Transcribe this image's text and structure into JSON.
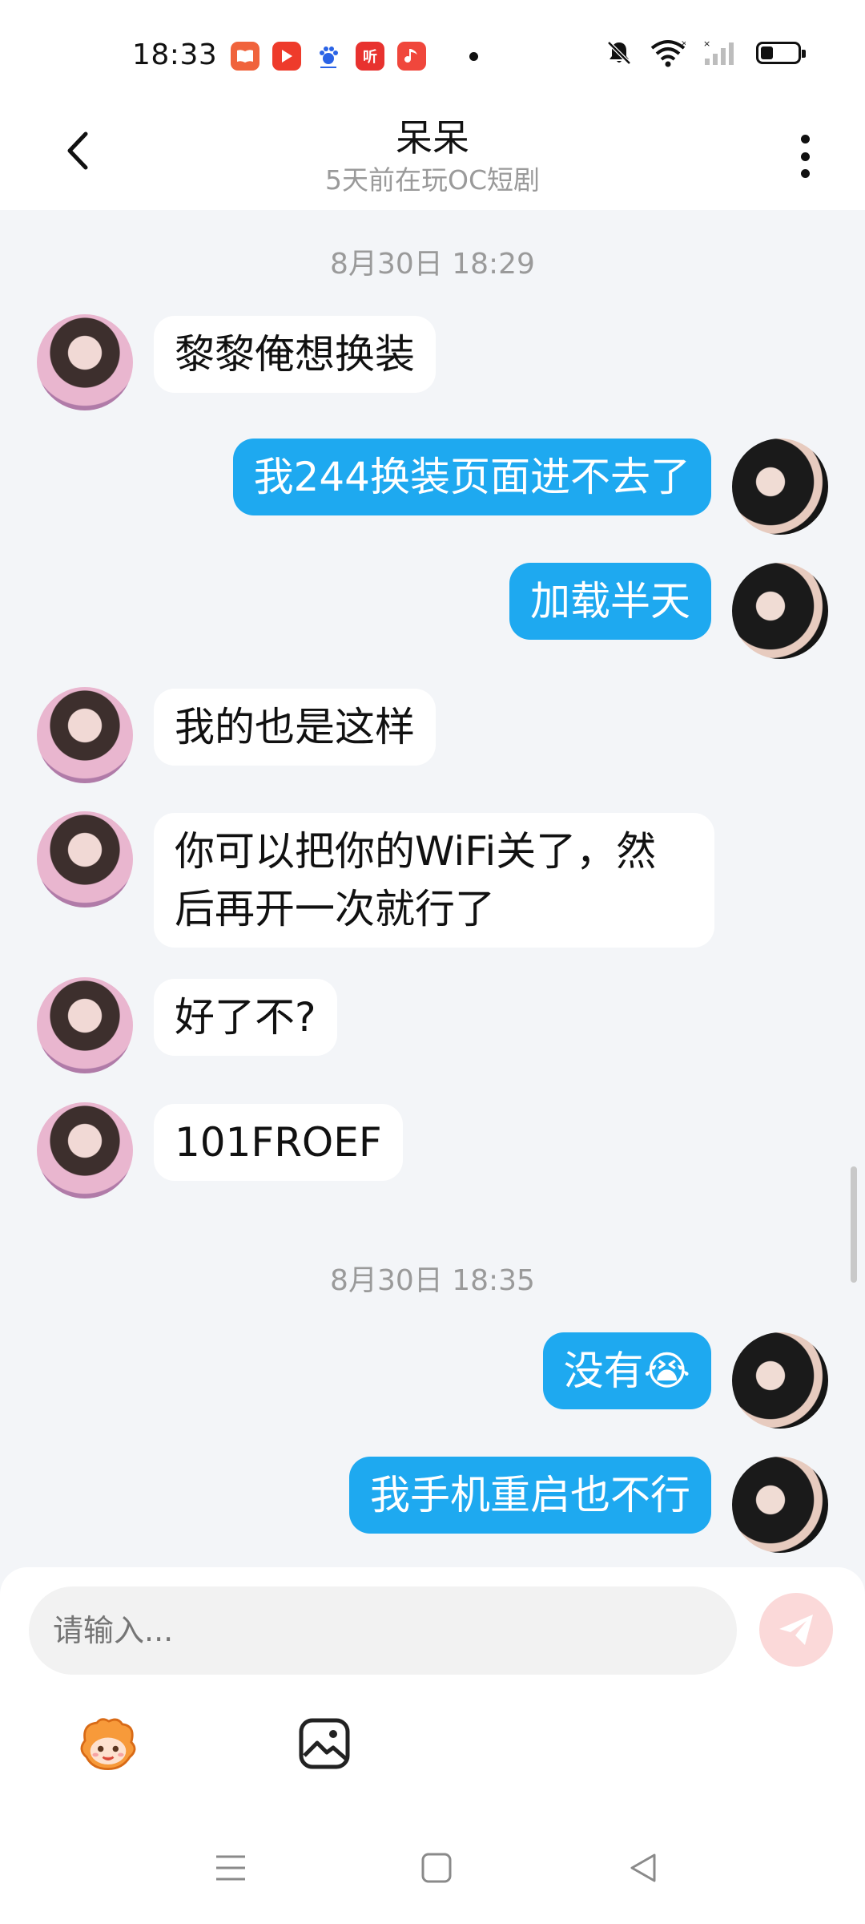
{
  "status_bar": {
    "time": "18:33",
    "app_icons": [
      "book-app-icon",
      "video-app-icon",
      "baidu-app-icon",
      "ting-app-icon",
      "music-app-icon"
    ],
    "ting_label": "听",
    "icons": [
      "mute-icon",
      "wifi-icon",
      "signal-icon",
      "battery-icon"
    ],
    "battery_level": 0.35
  },
  "header": {
    "title": "呆呆",
    "subtitle": "5天前在玩OC短剧"
  },
  "messages": [
    {
      "type": "timestamp",
      "text": "8月30日 18:29"
    },
    {
      "type": "message",
      "side": "peer",
      "text": "黎黎俺想换装"
    },
    {
      "type": "message",
      "side": "me",
      "text": "我244换装页面进不去了"
    },
    {
      "type": "message",
      "side": "me",
      "text": "加载半天"
    },
    {
      "type": "message",
      "side": "peer",
      "text": "我的也是这样"
    },
    {
      "type": "message",
      "side": "peer",
      "text": "你可以把你的WiFi关了，然后再开一次就行了"
    },
    {
      "type": "message",
      "side": "peer",
      "text": "好了不?"
    },
    {
      "type": "message",
      "side": "peer",
      "text": "101FROEF"
    },
    {
      "type": "timestamp",
      "text": "8月30日 18:35"
    },
    {
      "type": "message",
      "side": "me",
      "text": "没有😭"
    },
    {
      "type": "message",
      "side": "me",
      "text": "我手机重启也不行"
    }
  ],
  "composer": {
    "placeholder": "请输入...",
    "send_icon": "send-icon",
    "tools": [
      "sticker-icon",
      "image-icon"
    ]
  },
  "navbar": {
    "buttons": [
      "menu-nav-icon",
      "home-nav-icon",
      "back-nav-icon"
    ]
  },
  "colors": {
    "my_bubble": "#1ea9f0",
    "peer_bubble": "#ffffff",
    "chat_bg": "#f3f5f8",
    "send_button": "#fbd9d9"
  }
}
